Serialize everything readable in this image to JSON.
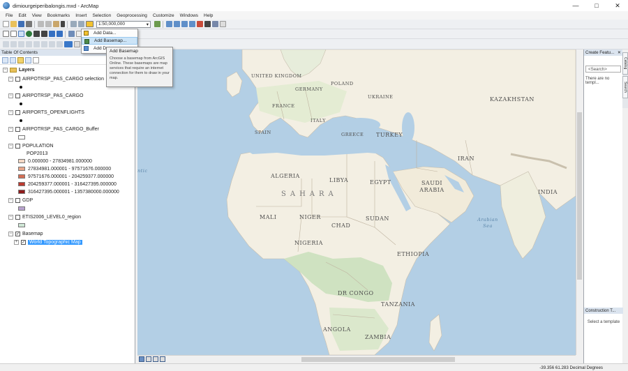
{
  "window": {
    "title": "dimiourgeiperibalongis.mxd - ArcMap",
    "minimize": "—",
    "maximize": "□",
    "close": "✕"
  },
  "menu": [
    "File",
    "Edit",
    "View",
    "Bookmarks",
    "Insert",
    "Selection",
    "Geoprocessing",
    "Customize",
    "Windows",
    "Help"
  ],
  "toolbar": {
    "scale": "1:50,000,000"
  },
  "add_data_menu": {
    "items": [
      "Add Data...",
      "Add Basemap...",
      "Add Data"
    ],
    "highlighted": 1
  },
  "tooltip": {
    "title": "Add Basemap",
    "body": "Choose a basemap from ArcGIS Online. These basemaps are map services that require an internet connection for them to draw in your map."
  },
  "toc": {
    "title": "Table Of Contents",
    "root": "Layers",
    "layers": [
      {
        "name": "AIRPOTRSP_PAS_CARGO selection",
        "symbol": "point"
      },
      {
        "name": "AIRPOTRSP_PAS_CARGO",
        "symbol": "point"
      },
      {
        "name": "AIRPORTS_OPENFLIGHTS",
        "symbol": "point"
      },
      {
        "name": "AIRPOTRSP_PAS_CARGO_Buffer",
        "symbol": "polygon"
      }
    ],
    "population": {
      "name": "POPULATION",
      "field": "POP2013",
      "classes": [
        {
          "label": "0.000000 - 27834981.000000",
          "color": "#f4d9c6"
        },
        {
          "label": "27834981.000001 - 97571676.000000",
          "color": "#e8a78a"
        },
        {
          "label": "97571676.000001 - 204259377.000000",
          "color": "#d46e55"
        },
        {
          "label": "204259377.000001 - 316427395.000000",
          "color": "#bc3b31"
        },
        {
          "label": "316427395.000001 - 1357380000.000000",
          "color": "#8f1b1b"
        }
      ]
    },
    "gdp": {
      "name": "GDP",
      "color": "#b9a3cf"
    },
    "etis": {
      "name": "ETIS2006_LEVEL0_region",
      "color": "#cfe7d6"
    },
    "basemap": {
      "name": "Basemap",
      "child": "World Topographic Map"
    }
  },
  "map": {
    "labels": [
      {
        "text": "UNITED KINGDOM",
        "cls": "small"
      },
      {
        "text": "POLAND",
        "cls": "small"
      },
      {
        "text": "GERMANY",
        "cls": "small"
      },
      {
        "text": "UKRAINE",
        "cls": "small"
      },
      {
        "text": "FRANCE",
        "cls": "small"
      },
      {
        "text": "KAZAKHSTAN",
        "cls": ""
      },
      {
        "text": "ITALY",
        "cls": "small"
      },
      {
        "text": "SPAIN",
        "cls": "small"
      },
      {
        "text": "GREECE",
        "cls": "small"
      },
      {
        "text": "TURKEY",
        "cls": ""
      },
      {
        "text": "IRAN",
        "cls": ""
      },
      {
        "text": "ALGERIA",
        "cls": ""
      },
      {
        "text": "LIBYA",
        "cls": ""
      },
      {
        "text": "EGYPT",
        "cls": ""
      },
      {
        "text": "SAUDI ARABIA",
        "cls": ""
      },
      {
        "text": "INDIA",
        "cls": ""
      },
      {
        "text": "SAHARA",
        "cls": "big"
      },
      {
        "text": "MALI",
        "cls": ""
      },
      {
        "text": "NIGER",
        "cls": ""
      },
      {
        "text": "CHAD",
        "cls": ""
      },
      {
        "text": "SUDAN",
        "cls": ""
      },
      {
        "text": "Arabian Sea",
        "cls": "water small"
      },
      {
        "text": "NIGERIA",
        "cls": ""
      },
      {
        "text": "ETHIOPIA",
        "cls": ""
      },
      {
        "text": "DR CONGO",
        "cls": ""
      },
      {
        "text": "TANZANIA",
        "cls": ""
      },
      {
        "text": "ANGOLA",
        "cls": ""
      },
      {
        "text": "ZAMBIA",
        "cls": ""
      },
      {
        "text": "ntic",
        "cls": "water small"
      }
    ]
  },
  "right_panel": {
    "title": "Create Featu...",
    "search": "<Search>",
    "message": "There are no templ...",
    "construction": "Construction T...",
    "template_hint": "Select a template",
    "tabs": [
      "Catalog",
      "Search"
    ]
  },
  "status": {
    "coords": "-39.356  61.283 Decimal Degrees"
  },
  "colors": {
    "ocean": "#b3cfe5",
    "land": "#f3efe3",
    "forest": "#cfe2c1",
    "selection": "#3399ff"
  }
}
